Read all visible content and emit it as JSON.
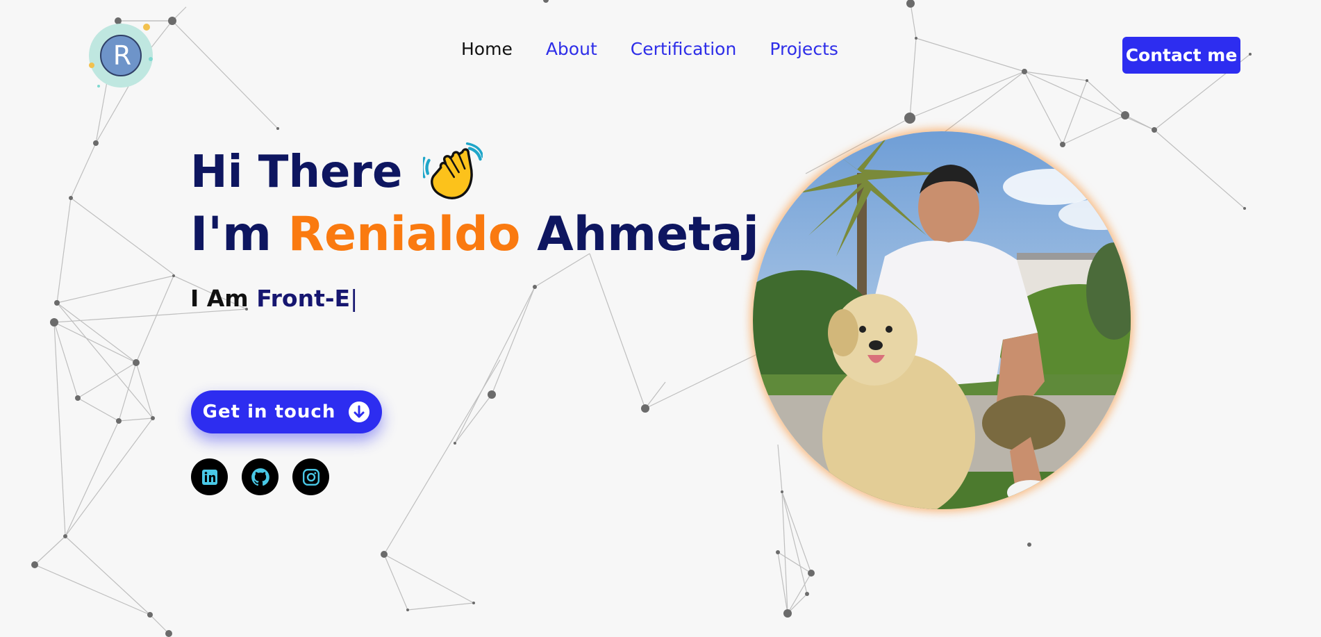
{
  "logo": {
    "letter": "R",
    "icon": "logo-icon"
  },
  "nav": {
    "links": [
      {
        "label": "Home",
        "active": true
      },
      {
        "label": "About",
        "active": false
      },
      {
        "label": "Certification",
        "active": false
      },
      {
        "label": "Projects",
        "active": false
      }
    ],
    "contact_label": "Contact me"
  },
  "hero": {
    "greeting": "Hi There",
    "greeting_icon": "waving-hand-icon",
    "intro_prefix": "I'm",
    "first_name": "Renialdo",
    "last_name": "Ahmetaj",
    "role_prefix": "I Am",
    "role_typed": "Front-E",
    "cursor": "|",
    "cta_label": "Get in touch",
    "cta_icon": "arrow-down-circle-icon"
  },
  "socials": [
    {
      "name": "linkedin",
      "icon": "linkedin-icon"
    },
    {
      "name": "github",
      "icon": "github-icon"
    },
    {
      "name": "instagram",
      "icon": "instagram-icon"
    }
  ],
  "profile_photo": {
    "subject": "man crouching with a fluffy dog outdoors"
  },
  "colors": {
    "background": "#f7f7f7",
    "navy": "#0e1660",
    "accent_blue": "#2d2df0",
    "accent_orange": "#fa7a10",
    "icon_cyan": "#49c8e6"
  }
}
